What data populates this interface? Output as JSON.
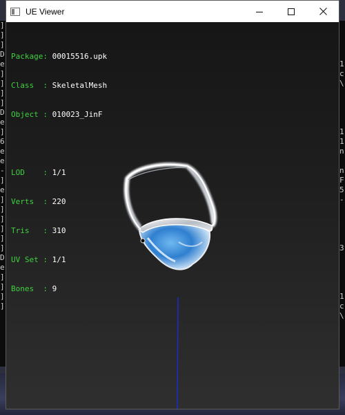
{
  "window": {
    "title": "UE Viewer",
    "controls": {
      "minimize_icon": "minimize-icon",
      "maximize_icon": "maximize-icon",
      "close_icon": "close-icon"
    }
  },
  "mesh_info": {
    "package": {
      "label": "Package",
      "value": "00015516.upk"
    },
    "class": {
      "label": "Class  ",
      "value": "SkeletalMesh"
    },
    "object": {
      "label": "Object ",
      "value": "010023_JinF"
    },
    "lod": {
      "label": "LOD    ",
      "value": "1/1"
    },
    "verts": {
      "label": "Verts  ",
      "value": "220"
    },
    "tris": {
      "label": "Tris   ",
      "value": "310"
    },
    "uv_set": {
      "label": "UV Set ",
      "value": "1/1"
    },
    "bones": {
      "label": "Bones  ",
      "value": "9"
    }
  },
  "background_console": {
    "left_chars": [
      "]",
      "]",
      "]",
      "D",
      "e",
      "]",
      "]",
      "]",
      "]",
      "D",
      "e",
      "]",
      "6",
      "e",
      "e",
      "-",
      "]",
      "e",
      "]",
      "]",
      "]",
      "]",
      "]",
      "]",
      "D",
      "e",
      "]",
      "]",
      "]",
      "]"
    ],
    "right_chars": [
      "",
      "",
      "",
      "",
      "1",
      "c",
      "\\",
      "",
      "",
      "",
      "",
      "1",
      "1",
      "n",
      "",
      "n",
      "F",
      "5",
      "-",
      "",
      "",
      "",
      "",
      "3",
      "",
      "",
      "",
      "",
      "1",
      "c",
      "\\"
    ]
  },
  "colors": {
    "label_green": "#3fd23f",
    "value_white": "#ffffff",
    "axis_blue": "#1b2bd0"
  }
}
